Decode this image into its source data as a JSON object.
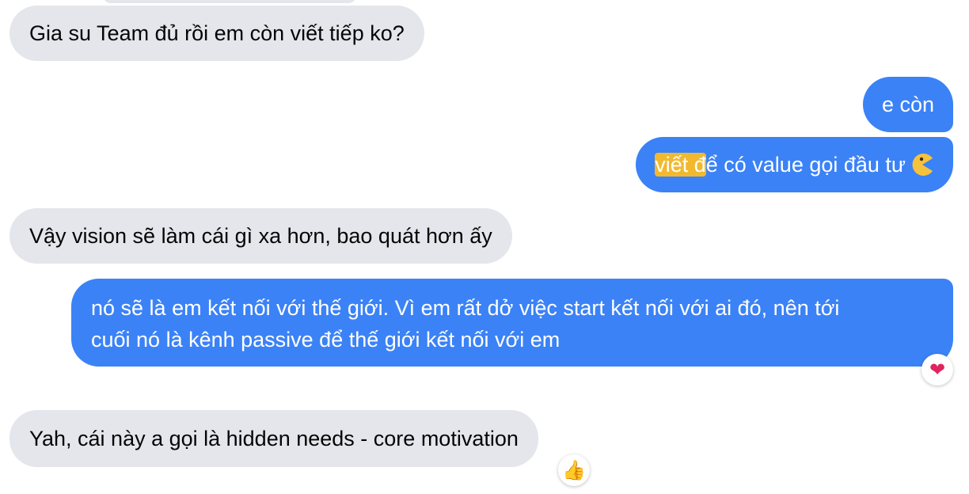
{
  "messages": [
    {
      "id": "m1",
      "direction": "incoming",
      "text": "Gia su Team đủ rồi em còn viết tiếp ko?"
    },
    {
      "id": "m2",
      "direction": "outgoing",
      "text": "e còn"
    },
    {
      "id": "m3",
      "direction": "outgoing",
      "highlighted_text": "viết đ",
      "text_after_highlight": "ể có value gọi đầu tư",
      "trailing_icon": "pacman-emoji-icon"
    },
    {
      "id": "m4",
      "direction": "incoming",
      "text": "Vậy vision sẽ làm cái gì xa hơn, bao quát hơn ấy"
    },
    {
      "id": "m5",
      "direction": "outgoing",
      "lines": [
        "nó sẽ là em kết nối với thế giới. Vì em rất dở việc start kết nối với ai đó, nên tới",
        "cuối nó là kênh passive để thế giới kết nối với em"
      ],
      "reaction": {
        "icon": "heart-icon",
        "glyph": "❤"
      }
    },
    {
      "id": "m6",
      "direction": "incoming",
      "text": "Yah, cái này a gọi là hidden needs - core motivation",
      "reaction": {
        "icon": "thumbs-up-icon",
        "glyph": "👍"
      }
    }
  ],
  "colors": {
    "incoming_bubble": "#e4e6eb",
    "outgoing_bubble": "#3b82f6",
    "highlight": "#f2b92e",
    "heart": "#e0245e",
    "thumbs": "#f5b90f"
  }
}
